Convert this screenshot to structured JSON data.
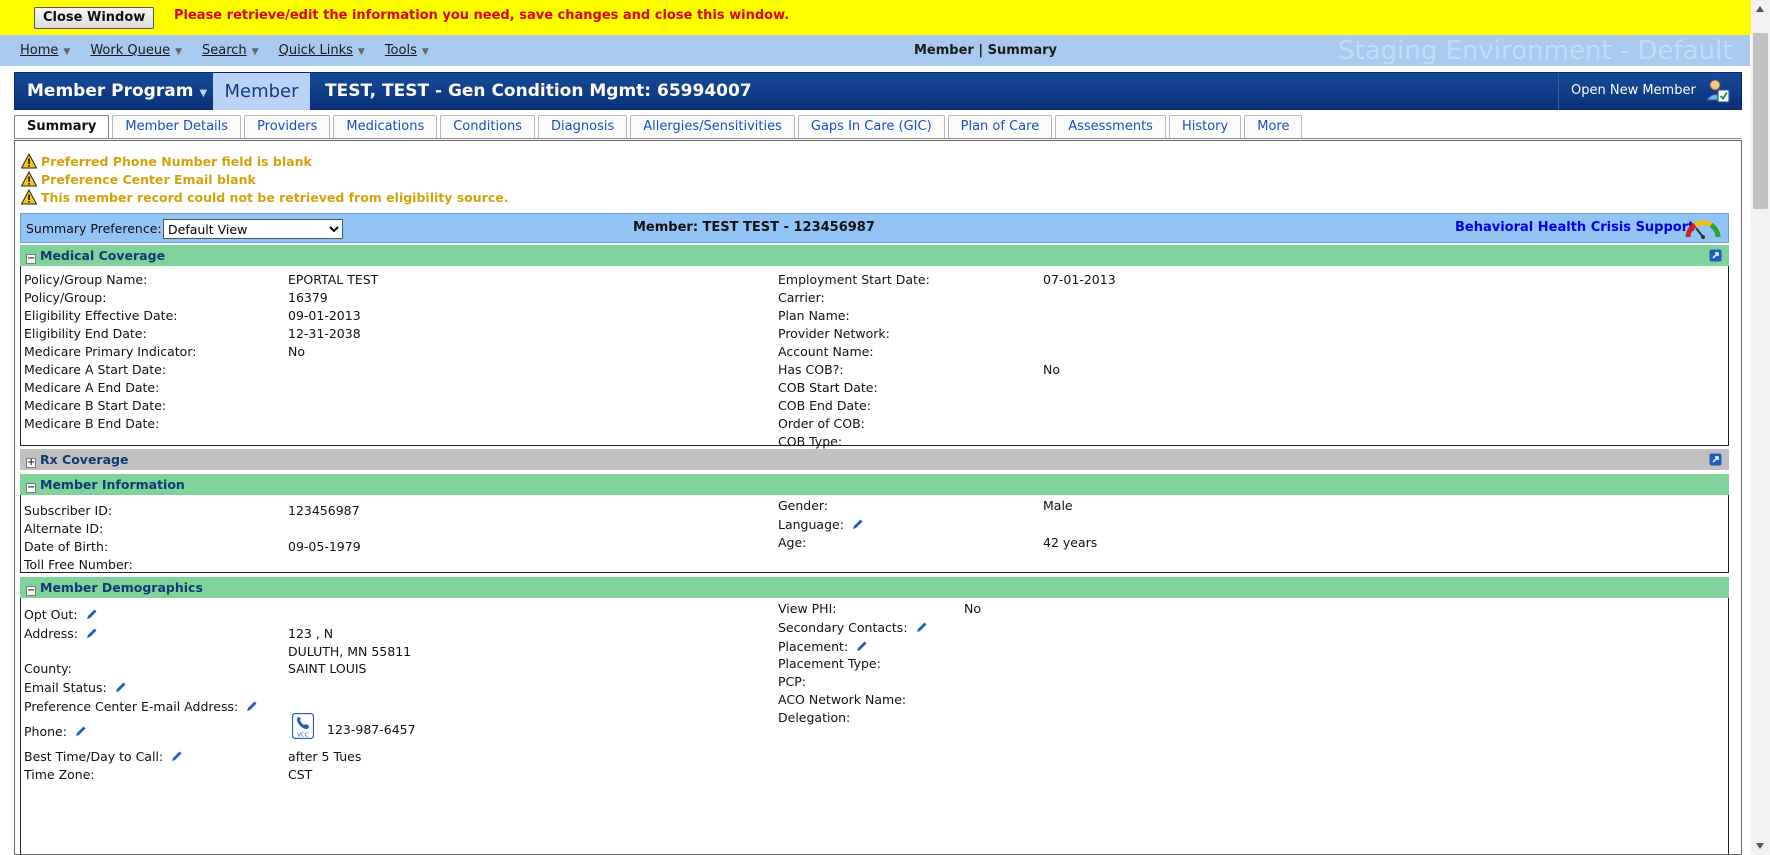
{
  "top_bar": {
    "close_button": "Close Window",
    "message": "Please retrieve/edit the information you need, save changes and close this window."
  },
  "menu": {
    "items": [
      {
        "label": "Home"
      },
      {
        "label": "Work Queue"
      },
      {
        "label": "Search"
      },
      {
        "label": "Quick Links"
      },
      {
        "label": "Tools"
      }
    ],
    "page_crumb": "Member | Summary",
    "environment": "Staging Environment - Default"
  },
  "header": {
    "program": "Member Program",
    "member_label": "Member",
    "member_title": "TEST, TEST - Gen Condition Mgmt: 65994007",
    "open_new": "Open New Member"
  },
  "tabs": [
    {
      "label": "Summary",
      "active": true
    },
    {
      "label": "Member Details"
    },
    {
      "label": "Providers"
    },
    {
      "label": "Medications"
    },
    {
      "label": "Conditions"
    },
    {
      "label": "Diagnosis"
    },
    {
      "label": "Allergies/Sensitivities"
    },
    {
      "label": "Gaps In Care (GIC)"
    },
    {
      "label": "Plan of Care"
    },
    {
      "label": "Assessments"
    },
    {
      "label": "History"
    },
    {
      "label": "More"
    }
  ],
  "alerts": [
    "Preferred Phone Number field is blank",
    "Preference Center Email blank",
    "This member record could not be retrieved from eligibility source."
  ],
  "summary_pref": {
    "label": "Summary Preference:",
    "selected": "Default View",
    "member": "Member: TEST TEST - 123456987",
    "crisis_link": "Behavioral Health Crisis Support"
  },
  "sections": {
    "medical": {
      "title": "Medical Coverage",
      "left": [
        {
          "label": "Policy/Group Name:",
          "value": "EPORTAL TEST"
        },
        {
          "label": "Policy/Group:",
          "value": "16379"
        },
        {
          "label": "Eligibility Effective Date:",
          "value": "09-01-2013"
        },
        {
          "label": "Eligibility End Date:",
          "value": "12-31-2038"
        },
        {
          "label": "Medicare Primary Indicator:",
          "value": "No"
        },
        {
          "label": "Medicare A Start Date:",
          "value": ""
        },
        {
          "label": "Medicare A End Date:",
          "value": ""
        },
        {
          "label": "Medicare B Start Date:",
          "value": ""
        },
        {
          "label": "Medicare B End Date:",
          "value": ""
        }
      ],
      "right": [
        {
          "label": "Employment Start Date:",
          "value": "07-01-2013"
        },
        {
          "label": "Carrier:",
          "value": ""
        },
        {
          "label": "Plan Name:",
          "value": ""
        },
        {
          "label": "Provider Network:",
          "value": ""
        },
        {
          "label": "Account Name:",
          "value": ""
        },
        {
          "label": "Has COB?:",
          "value": "No"
        },
        {
          "label": "COB Start Date:",
          "value": ""
        },
        {
          "label": "COB End Date:",
          "value": ""
        },
        {
          "label": "Order of COB:",
          "value": ""
        },
        {
          "label": "COB Type:",
          "value": ""
        }
      ]
    },
    "rx": {
      "title": "Rx Coverage"
    },
    "member_info": {
      "title": "Member Information",
      "left": [
        {
          "label": "Subscriber ID:",
          "value": "123456987"
        },
        {
          "label": "Alternate ID:",
          "value": ""
        },
        {
          "label": "Date of Birth:",
          "value": "09-05-1979"
        },
        {
          "label": "Toll Free Number:",
          "value": ""
        }
      ],
      "right": [
        {
          "label": "Gender:",
          "value": "Male"
        },
        {
          "label": "Language:",
          "value": ""
        },
        {
          "label": "Age:",
          "value": "42 years"
        }
      ]
    },
    "demographics": {
      "title": "Member Demographics",
      "left": [
        {
          "label": "Opt Out:",
          "value": ""
        },
        {
          "label": "Address:",
          "value": "123 , N",
          "value2": "DULUTH, MN 55811"
        },
        {
          "label": "County:",
          "value": "SAINT LOUIS"
        },
        {
          "label": "Email Status:",
          "value": ""
        },
        {
          "label": "Preference Center E-mail Address:",
          "value": ""
        },
        {
          "label": "Phone:",
          "value": "123-987-6457",
          "vcc_text": "VCC"
        },
        {
          "label": "Best Time/Day to Call:",
          "value": "after 5 Tues"
        },
        {
          "label": "Time Zone:",
          "value": "CST"
        }
      ],
      "right": [
        {
          "label": "View PHI:",
          "value": "No"
        },
        {
          "label": "Secondary Contacts:",
          "value": ""
        },
        {
          "label": "Placement:",
          "value": ""
        },
        {
          "label": "Placement Type:",
          "value": ""
        },
        {
          "label": "PCP:",
          "value": ""
        },
        {
          "label": "ACO Network Name:",
          "value": ""
        },
        {
          "label": "Delegation:",
          "value": ""
        }
      ]
    }
  },
  "icons": {
    "warning": "warning-triangle-icon",
    "edit": "pencil-icon",
    "external": "external-link-icon",
    "gauge": "gauge-icon",
    "phone": "vcc-phone-icon"
  },
  "colors": {
    "top_bar": "#ffff00",
    "menu_bar": "#a9c9ef",
    "header": "#0b3179",
    "section_green": "#7fd39a",
    "section_gray": "#c0c0c0",
    "alert_text": "#d4a20c",
    "link": "#1a4cc9"
  }
}
